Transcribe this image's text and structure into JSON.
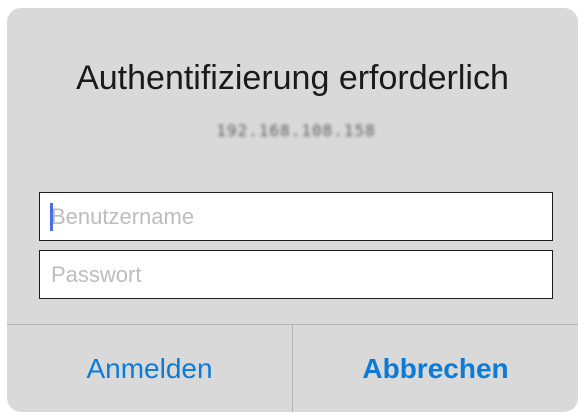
{
  "dialog": {
    "title": "Authentifizierung erforderlich",
    "host": "192.168.108.158"
  },
  "fields": {
    "username": {
      "placeholder": "Benutzername",
      "value": ""
    },
    "password": {
      "placeholder": "Passwort",
      "value": ""
    }
  },
  "actions": {
    "login_label": "Anmelden",
    "cancel_label": "Abbrechen"
  },
  "colors": {
    "dialog_background": "#d9d9d9",
    "action_text": "#0a7bd8",
    "cursor": "#4a6fe3"
  }
}
